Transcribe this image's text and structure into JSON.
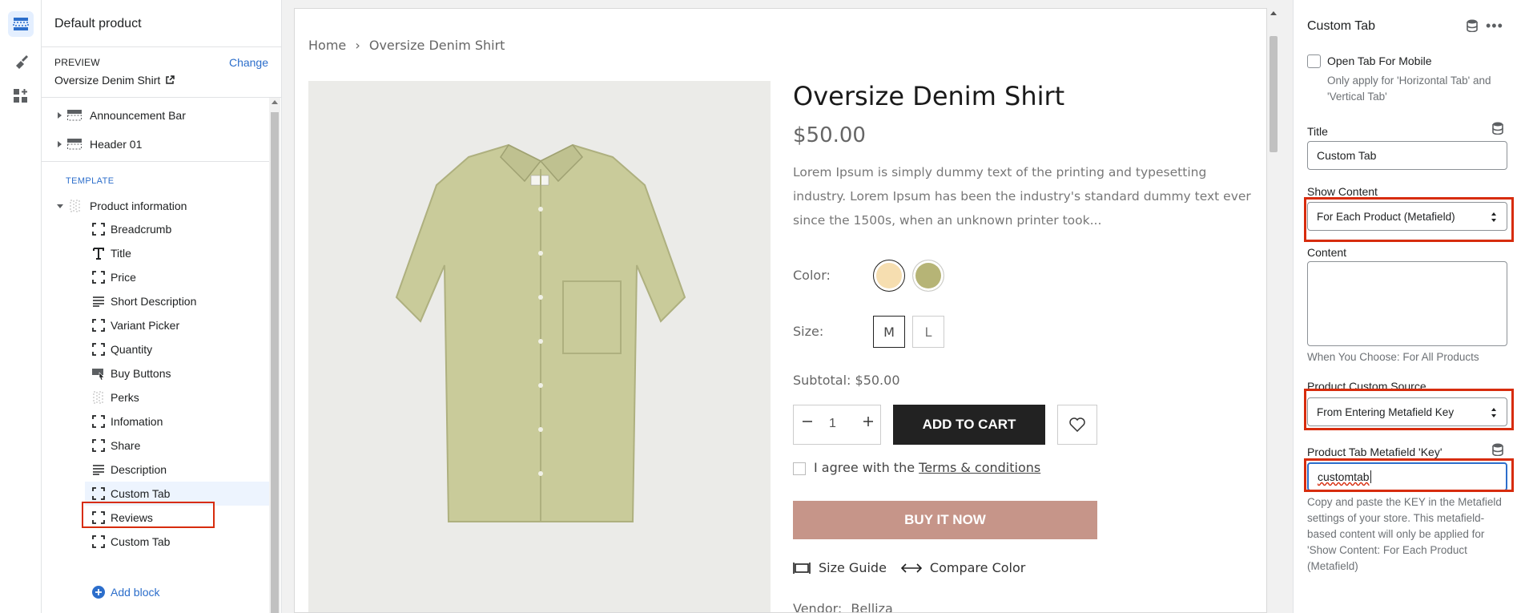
{
  "sidebar": {
    "title": "Default product",
    "preview_label": "PREVIEW",
    "change_label": "Change",
    "preview_value": "Oversize Denim Shirt",
    "sections": [
      {
        "label": "Announcement Bar"
      },
      {
        "label": "Header 01"
      }
    ],
    "template_label": "TEMPLATE",
    "template_section": "Product information",
    "blocks": [
      {
        "label": "Breadcrumb",
        "icon": "dashed-square-icon"
      },
      {
        "label": "Title",
        "icon": "text-icon"
      },
      {
        "label": "Price",
        "icon": "dashed-square-icon"
      },
      {
        "label": "Short Description",
        "icon": "paragraph-icon"
      },
      {
        "label": "Variant Picker",
        "icon": "dashed-square-icon"
      },
      {
        "label": "Quantity",
        "icon": "dashed-square-icon"
      },
      {
        "label": "Buy Buttons",
        "icon": "cursor-button-icon"
      },
      {
        "label": "Perks",
        "icon": "perks-icon"
      },
      {
        "label": "Infomation",
        "icon": "dashed-square-icon"
      },
      {
        "label": "Share",
        "icon": "dashed-square-icon"
      },
      {
        "label": "Description",
        "icon": "paragraph-icon"
      },
      {
        "label": "Custom Tab",
        "icon": "dashed-square-icon"
      },
      {
        "label": "Reviews",
        "icon": "dashed-square-icon"
      },
      {
        "label": "Custom Tab",
        "icon": "dashed-square-icon"
      }
    ],
    "add_block_label": "Add block"
  },
  "preview": {
    "breadcrumb_home": "Home",
    "breadcrumb_sep": "›",
    "breadcrumb_current": "Oversize Denim Shirt",
    "product_title": "Oversize Denim Shirt",
    "price": "$50.00",
    "description": "Lorem Ipsum is simply dummy text of the printing and typesetting industry. Lorem Ipsum has been the industry's standard dummy text ever since the 1500s, when an unknown printer took...",
    "color_label": "Color:",
    "colors": [
      "#f6deb0",
      "#b6b476"
    ],
    "size_label": "Size:",
    "sizes": [
      "M",
      "L"
    ],
    "subtotal": "Subtotal: $50.00",
    "quantity": "1",
    "add_to_cart": "ADD TO CART",
    "agree_text": "I agree with the",
    "terms_link": "Terms & conditions",
    "buy_now": "BUY IT NOW",
    "size_guide": "Size Guide",
    "compare_color": "Compare Color",
    "vendor_label": "Vendor:",
    "vendor_value": "Belliza"
  },
  "settings": {
    "title": "Custom Tab",
    "open_mobile_label": "Open Tab For Mobile",
    "open_mobile_help": "Only apply for 'Horizontal Tab' and 'Vertical Tab'",
    "title_label": "Title",
    "title_value": "Custom Tab",
    "show_content_label": "Show Content",
    "show_content_value": "For Each Product (Metafield)",
    "content_label": "Content",
    "content_help": "When You Choose: For All Products",
    "source_label": "Product Custom Source",
    "source_value": "From Entering Metafield Key",
    "key_label": "Product Tab Metafield 'Key'",
    "key_value": "customtab",
    "key_help": "Copy and paste the KEY in the Metafield settings of your store. This metafield-based content will only be applied for 'Show Content: For Each Product (Metafield)"
  }
}
